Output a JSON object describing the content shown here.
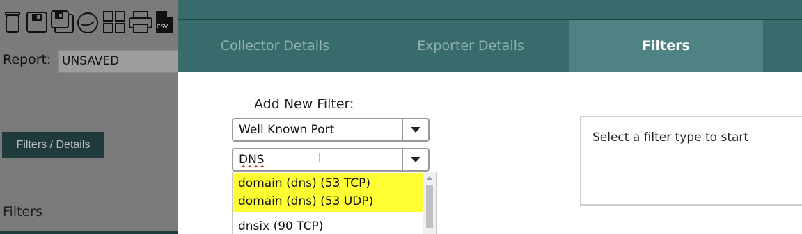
{
  "toolbar": {
    "icons": [
      "trash-icon",
      "save-icon",
      "save-as-icon",
      "schedule-icon",
      "dashboard-icon",
      "print-icon",
      "csv-export-icon"
    ],
    "csv_badge": "CSV"
  },
  "report": {
    "label": "Report:",
    "name": "UNSAVED"
  },
  "left_panel": {
    "filters_details_button": "Filters / Details",
    "filters_heading": "Filters"
  },
  "dialog": {
    "tabs": [
      {
        "label": "Collector Details",
        "active": false
      },
      {
        "label": "Exporter Details",
        "active": false
      },
      {
        "label": "Filters",
        "active": true
      }
    ],
    "add_filter_label": "Add New Filter:",
    "filter_type": {
      "selected": "Well Known Port"
    },
    "filter_value": {
      "value": "DNS"
    },
    "dropdown_options": [
      {
        "label": "domain (dns) (53 TCP)",
        "highlighted": true
      },
      {
        "label": "domain (dns) (53 UDP)",
        "highlighted": true
      },
      {
        "label": "dnsix (90 TCP)",
        "highlighted": false
      }
    ],
    "info_text": "Select a filter type to start"
  },
  "colors": {
    "header_teal": "#386c6c",
    "active_tab": "#4f8282",
    "overlay_gray": "#7b7b7b",
    "highlight_yellow": "#ffff33"
  }
}
